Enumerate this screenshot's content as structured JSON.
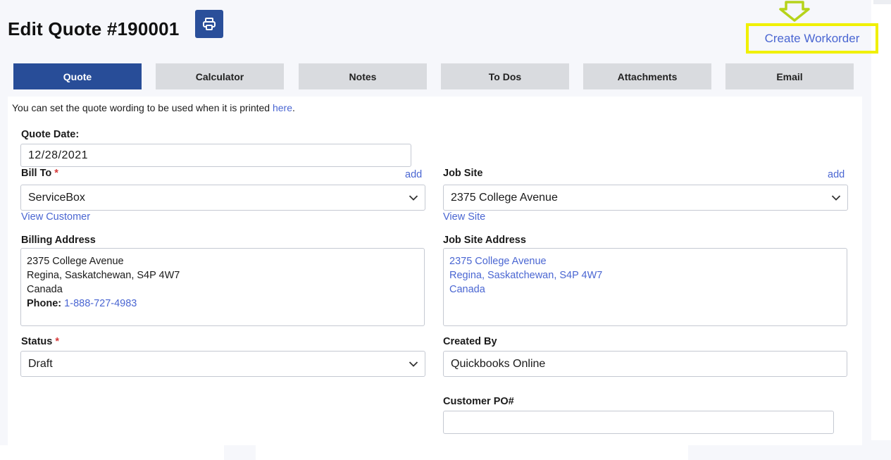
{
  "header": {
    "title": "Edit Quote #190001",
    "create_workorder": "Create Workorder"
  },
  "tabs": [
    {
      "label": "Quote",
      "active": true
    },
    {
      "label": "Calculator",
      "active": false
    },
    {
      "label": "Notes",
      "active": false
    },
    {
      "label": "To Dos",
      "active": false
    },
    {
      "label": "Attachments",
      "active": false
    },
    {
      "label": "Email",
      "active": false
    }
  ],
  "hint": {
    "text": "You can set the quote wording to be used when it is printed ",
    "link": "here",
    "end": "."
  },
  "form": {
    "quote_date_label": "Quote Date:",
    "quote_date_value": "12/28/2021",
    "bill_to_label": "Bill To",
    "required_mark": "*",
    "add_label": "add",
    "bill_to_value": "ServiceBox",
    "view_customer": "View Customer",
    "job_site_label": "Job Site",
    "job_site_value": "2375 College Avenue",
    "view_site": "View Site",
    "billing_address_label": "Billing Address",
    "billing_address_lines": [
      "2375 College Avenue",
      "Regina, Saskatchewan, S4P 4W7",
      "Canada"
    ],
    "phone_label": "Phone:",
    "phone_value": "1-888-727-4983",
    "job_site_address_label": "Job Site Address",
    "job_site_address_lines": [
      "2375 College Avenue",
      "Regina, Saskatchewan, S4P 4W7",
      "Canada"
    ],
    "status_label": "Status",
    "status_value": "Draft",
    "created_by_label": "Created By",
    "created_by_value": "Quickbooks Online",
    "customer_po_label": "Customer PO#",
    "customer_po_value": ""
  },
  "colors": {
    "accent": "#284d98",
    "link": "#4a66d2",
    "highlight": "#f0f000",
    "required": "#d63a3a"
  },
  "icons": [
    "printer-icon",
    "chevron-down-icon",
    "down-arrow-hint-icon"
  ]
}
